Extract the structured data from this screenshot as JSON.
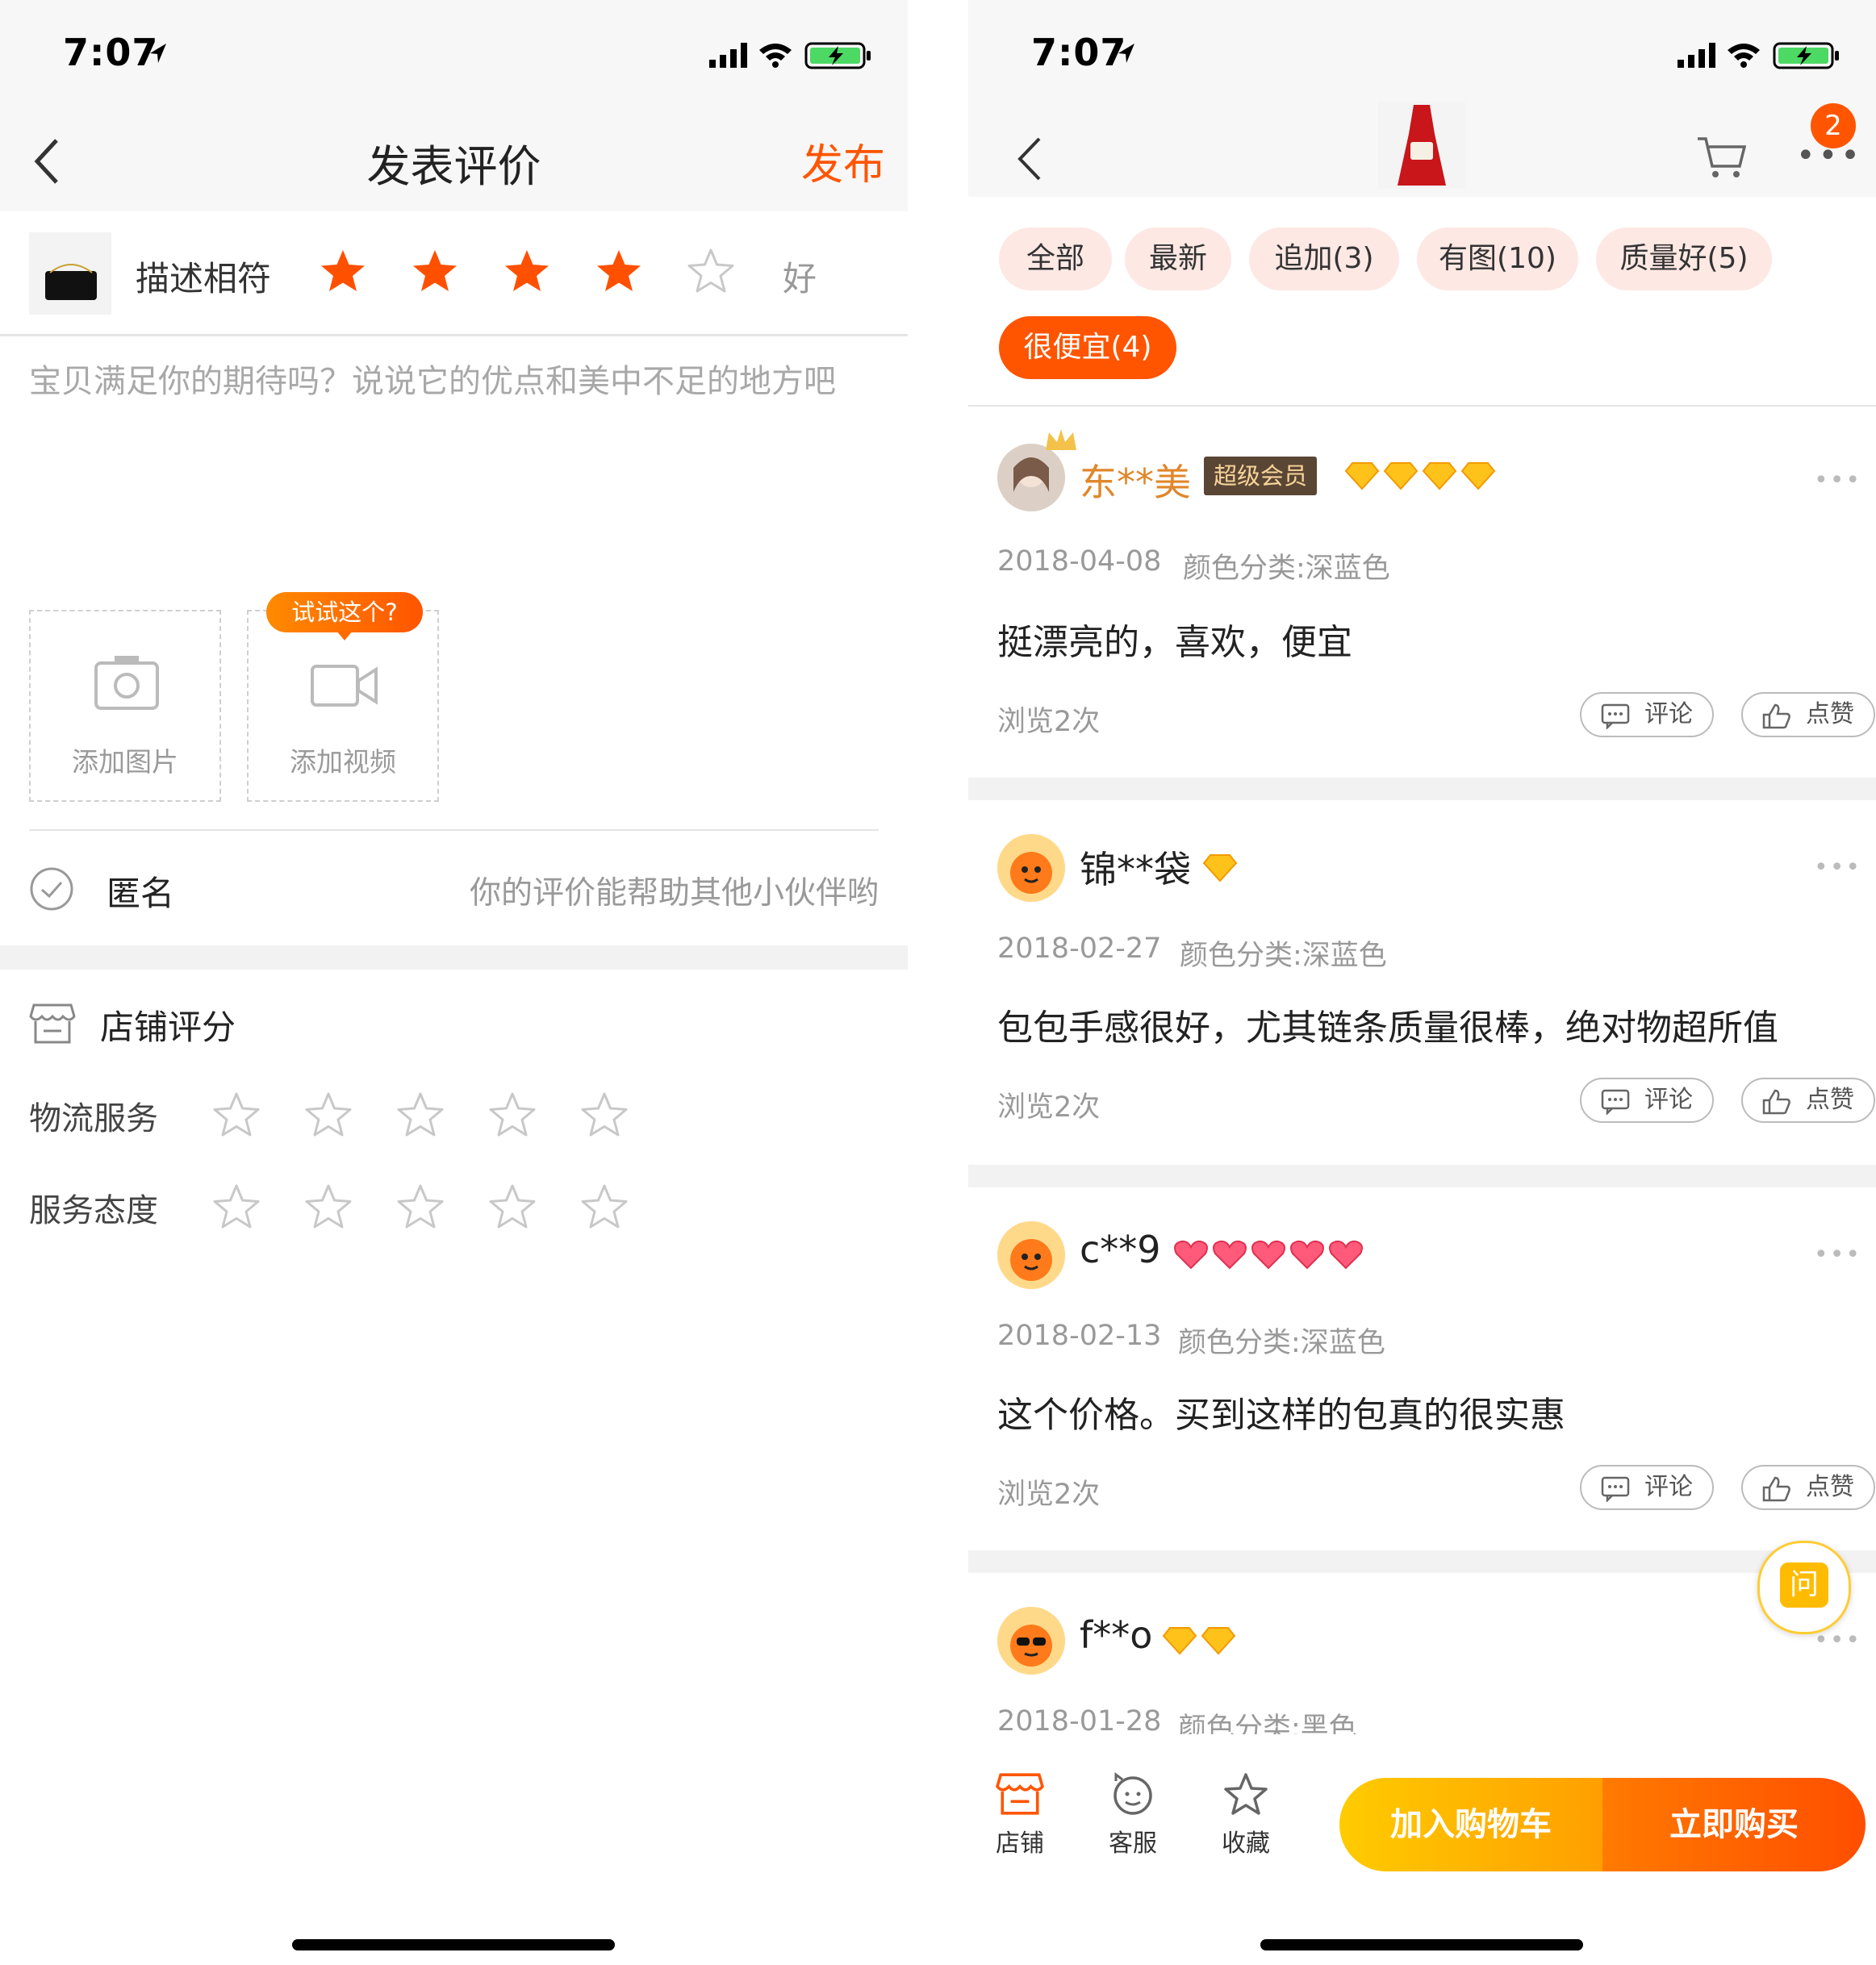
{
  "status": {
    "time": "7:07"
  },
  "left": {
    "nav": {
      "title": "发表评价",
      "publish": "发布"
    },
    "product": {
      "label": "描述相符",
      "rating_word": "好",
      "rating": 4,
      "max": 5
    },
    "textarea": {
      "placeholder": "宝贝满足你的期待吗？说说它的优点和美中不足的地方吧"
    },
    "upload": {
      "tooltip": "试试这个?",
      "add_photo": "添加图片",
      "add_video": "添加视频"
    },
    "anonymous": {
      "label": "匿名",
      "hint": "你的评价能帮助其他小伙伴哟"
    },
    "shop": {
      "title": "店铺评分",
      "rows": [
        {
          "label": "物流服务",
          "rating": 0
        },
        {
          "label": "服务态度",
          "rating": 0
        }
      ]
    }
  },
  "right": {
    "nav": {
      "badge": "2"
    },
    "filters": [
      {
        "label": "全部",
        "active": false
      },
      {
        "label": "最新",
        "active": false
      },
      {
        "label": "追加(3)",
        "active": false
      },
      {
        "label": "有图(10)",
        "active": false
      },
      {
        "label": "质量好(5)",
        "active": false
      },
      {
        "label": "很便宜(4)",
        "active": true
      }
    ],
    "reviews": [
      {
        "user": "东**美",
        "member": "超级会员",
        "date": "2018-04-08",
        "spec": "颜色分类:深蓝色",
        "text": "挺漂亮的，喜欢，便宜",
        "views": "浏览2次",
        "comment": "评论",
        "like": "点赞",
        "gems": 4,
        "gem_type": "diamond"
      },
      {
        "user": "锦**袋",
        "member": "",
        "date": "2018-02-27",
        "spec": "颜色分类:深蓝色",
        "text": "包包手感很好，尤其链条质量很棒，绝对物超所值",
        "views": "浏览2次",
        "comment": "评论",
        "like": "点赞",
        "gems": 1,
        "gem_type": "diamond"
      },
      {
        "user": "c**9",
        "member": "",
        "date": "2018-02-13",
        "spec": "颜色分类:深蓝色",
        "text": "这个价格。买到这样的包真的很实惠",
        "views": "浏览2次",
        "comment": "评论",
        "like": "点赞",
        "gems": 5,
        "gem_type": "heart"
      },
      {
        "user": "f**o",
        "member": "",
        "date": "2018-01-28",
        "spec": "颜色分类:黑色",
        "text": "",
        "views": "",
        "comment": "",
        "like": "",
        "gems": 2,
        "gem_type": "diamond"
      }
    ],
    "ask": "问",
    "tabbar": {
      "shop": "店铺",
      "service": "客服",
      "favorite": "收藏",
      "cart": "加入购物车",
      "buy": "立即购买"
    }
  },
  "colors": {
    "accent": "#ff5500",
    "star": "#ff5000",
    "gold": "#ffcc00",
    "gray_text": "#999999"
  }
}
